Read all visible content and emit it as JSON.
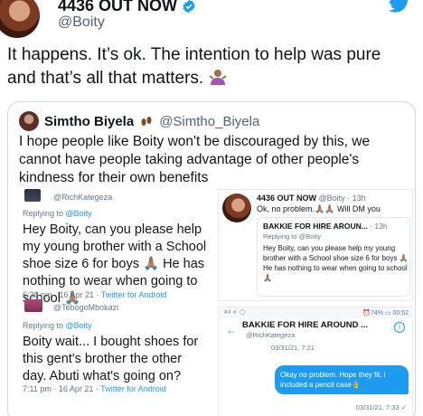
{
  "colors": {
    "accent": "#1d9bf0",
    "text": "#0f1419",
    "muted": "#536471",
    "border": "#cfd9de"
  },
  "icons": {
    "verified": "verified-badge-icon",
    "bird": "twitter-bird-icon",
    "shrug": "person-shrugging-emoji",
    "feet": "footprints-emoji",
    "hands": "folded-hands-emoji"
  },
  "author": {
    "name": "4436 OUT NOW",
    "handle": "@Boity"
  },
  "tweet": {
    "text": "It happens. It’s ok. The intention to help was pure and that’s all that matters."
  },
  "quote": {
    "name": "Simtho Biyela",
    "handle": "@Simtho_Biyela",
    "text": "I hope people like Boity  won't be discouraged by this, we cannot have people taking advantage of other people's kindness for their own benefits",
    "left_shot": {
      "reply1": {
        "handle": "@RichKategeza",
        "replying_prefix": "Replying to ",
        "replying_to": "@Boity",
        "body": "Hey Boity, can you please help my young brother with a School shoe size 6 for boys 🙏🏽 He has nothing to wear when going to school 🙏🏽",
        "time": "6:28 pm · 16 Apr 21 · ",
        "client": "Twitter for Android"
      },
      "reply2": {
        "handle": "@TebogoMbokazi",
        "replying_prefix": "Replying to ",
        "replying_to": "@Boity",
        "body": "Boity wait... I bought shoes for this gent's brother the other day. Abuti what's going on?",
        "time": "7:11 pm · 16 Apr 21 · ",
        "client": "Twitter for Android"
      }
    },
    "right_shot": {
      "card": {
        "name": "4436 OUT NOW",
        "meta": " @Boity · 13h",
        "text": "Ok, no problem.🙏🏽🙏🏽 Will DM you",
        "inner_name": "BAKKIE FOR HIRE AROUN...",
        "inner_meta": " · 13h",
        "inner_reply": "Replying to @Boity",
        "inner_body": "Hey Boity, can you please help my young brother with a School shoe size 6 for boys 🙏🏽 He has nothing to wear when going to school 🙏🏽"
      },
      "dm": {
        "status_left": "ᴬ⁴ᴵ ⁴ᴵ 🗨",
        "status_right": "⏰74% ▭ 00:52",
        "back": "←",
        "name": "BAKKIE FOR HIRE AROUND ...",
        "handle": "@RichKategeza",
        "info": "i",
        "date1": "03/31/21, 7:21",
        "bubble": "Okay no problem. Hope they fit, i included a pencil case👌",
        "date2": "03/31/21, 7:33 ✓"
      }
    }
  }
}
